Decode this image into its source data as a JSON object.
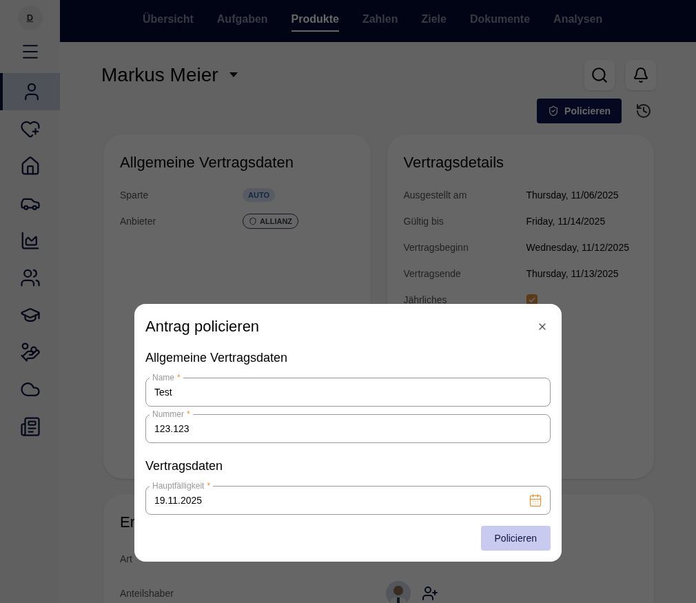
{
  "sidebar": {
    "avatar": "D",
    "items": [
      {
        "kind": "person",
        "selected": true
      },
      {
        "kind": "heart",
        "selected": false
      },
      {
        "kind": "home",
        "selected": false
      },
      {
        "kind": "car",
        "selected": false
      },
      {
        "kind": "chart",
        "selected": false
      },
      {
        "kind": "family",
        "selected": false
      },
      {
        "kind": "education",
        "selected": false
      },
      {
        "kind": "mortgage",
        "selected": false
      },
      {
        "kind": "cloud",
        "selected": false
      },
      {
        "kind": "news",
        "selected": false
      }
    ]
  },
  "nav_tabs": [
    {
      "label": "Übersicht",
      "selected": false
    },
    {
      "label": "Aufgaben",
      "selected": false
    },
    {
      "label": "Produkte",
      "selected": true
    },
    {
      "label": "Zahlen",
      "selected": false
    },
    {
      "label": "Ziele",
      "selected": false
    },
    {
      "label": "Dokumente",
      "selected": false
    },
    {
      "label": "Analysen",
      "selected": false
    }
  ],
  "header": {
    "title": "Markus Meier",
    "action_button": "Policieren"
  },
  "general_card": {
    "title": "Allgemeine Vertragsdaten",
    "rows": [
      {
        "label": "Sparte",
        "kind": "tag",
        "value": "AUTO"
      },
      {
        "label": "Anbieter",
        "kind": "provider",
        "value": "ALLIANZ"
      }
    ]
  },
  "details_card": {
    "title": "Vertragsdetails",
    "rows": [
      {
        "label": "Ausgestellt am",
        "kind": "text",
        "value": "Thursday, 11/06/2025"
      },
      {
        "label": "Gültig bis",
        "kind": "text",
        "value": "Friday, 11/14/2025"
      },
      {
        "label": "Vertragsbeginn",
        "kind": "text",
        "value": "Wednesday, 11/12/2025"
      },
      {
        "label": "Vertragsende",
        "kind": "text",
        "value": "Thursday, 11/13/2025"
      },
      {
        "label": "Jährliches",
        "kind": "checkbox",
        "checked": true
      }
    ]
  },
  "lower_card": {
    "title": "Er",
    "rows": [
      {
        "label": "Art",
        "kind": "none"
      },
      {
        "label": "Anteilshaber",
        "kind": "people"
      }
    ]
  },
  "dialog": {
    "title": "Antrag policieren",
    "sections": [
      {
        "title": "Allgemeine Vertragsdaten",
        "fields": [
          {
            "label": "Name",
            "required_mark": "*",
            "value": "Test",
            "kind": "text"
          },
          {
            "label": "Nummer",
            "required_mark": "*",
            "value": "123.123",
            "kind": "text"
          }
        ]
      },
      {
        "title": "Vertragsdaten",
        "fields": [
          {
            "label": "Hauptfälligkeit",
            "required_mark": "*",
            "value": "19.11.2025",
            "kind": "date"
          }
        ]
      }
    ],
    "submit_button": "Policieren"
  }
}
